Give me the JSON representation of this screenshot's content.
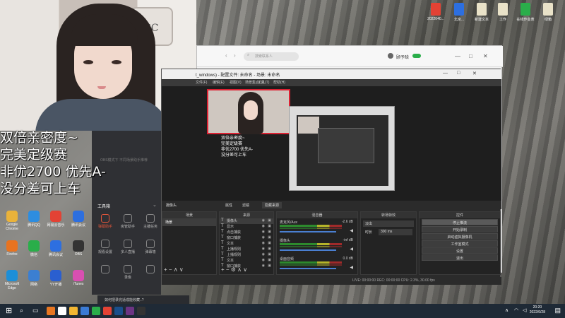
{
  "overlay": {
    "lines": [
      "双倍亲密度~",
      "完美定级赛",
      "非优2700 优先A-",
      "没分差可上车"
    ]
  },
  "camera": {
    "bag_logo": "CC"
  },
  "tool_app": {
    "title": "工具箱",
    "hint": "OBS模式下 不同场景助手推荐",
    "items": [
      "弹幕助手",
      "房管助手",
      "主播任务",
      "观看设置",
      "多人直播",
      "弹幕墙",
      "",
      "录像",
      ""
    ]
  },
  "notification": {
    "text": "如何把录完适成能收藏..?"
  },
  "desktop_left_icons": [
    {
      "label": "Google Chrome",
      "color": "#e9b23a"
    },
    {
      "label": "腾讯QQ",
      "color": "#2d8de0"
    },
    {
      "label": "网易云音乐",
      "color": "#e34234"
    },
    {
      "label": "腾讯会议",
      "color": "#2d6fe0"
    },
    {
      "label": "Firefox",
      "color": "#e8731f"
    },
    {
      "label": "微信",
      "color": "#2aae4a"
    },
    {
      "label": "腾讯会议",
      "color": "#2d6fe0"
    },
    {
      "label": "OBS",
      "color": "#333"
    },
    {
      "label": "Microsoft Edge",
      "color": "#1d8fd8"
    },
    {
      "label": "网络",
      "color": "#3c7fd1"
    },
    {
      "label": "YY开播",
      "color": "#2a5fd0"
    },
    {
      "label": "iTunes",
      "color": "#d94fb1"
    }
  ],
  "desktop_right_files": [
    {
      "label": "2022040...",
      "color": "#e34234"
    },
    {
      "label": "北京...",
      "color": "#2d6fe0"
    },
    {
      "label": "新建文本",
      "color": "#e9e2c8"
    },
    {
      "label": "工作",
      "color": "#e9e2c8"
    },
    {
      "label": "在线作业表",
      "color": "#2aae4a"
    },
    {
      "label": "绿箱",
      "color": "#e9e2c8"
    }
  ],
  "browser": {
    "search_placeholder": "搜索联系人",
    "user_name": "顾予晗",
    "controls": [
      "—",
      "□",
      "✕"
    ]
  },
  "obs": {
    "title": "t_windows) - 配置文件: 未命名 - 场景: 未命名",
    "menu": [
      "文件(F)",
      "编辑(E)",
      "视图(V)",
      "场景集合(S)",
      "工具(T)",
      "帮助(H)"
    ],
    "scene_label": "摄像头",
    "scene_buttons": [
      "属性",
      "滤镜",
      "隐藏来源"
    ],
    "panels": {
      "scenes": "场景",
      "sources": "来源",
      "mixer": "混音器",
      "transitions": "转场特效",
      "controls": "控件"
    },
    "scenes": [
      "场景"
    ],
    "sources": [
      "摄像头",
      "显示",
      "点击捕获",
      "窗口捕获",
      "文本",
      "上播规则",
      "上播规则",
      "文本",
      "窗口捕获"
    ],
    "mixer": [
      {
        "name": "麦克风/Aux",
        "level": "-2.6 dB"
      },
      {
        "name": "摄像头",
        "level": "-inf dB"
      },
      {
        "name": "桌面音频",
        "level": "0.0 dB"
      }
    ],
    "transition": {
      "type": "淡出",
      "duration_label": "时长",
      "duration": "300 ms"
    },
    "control_buttons": [
      "停止推流",
      "开始录制",
      "启动虚拟摄像机",
      "工作室模式",
      "设置",
      "退出"
    ],
    "status": "LIVE: 00:00:00   REC: 00:00:00   CPU: 2.3%, 30.00 fps"
  },
  "taskbar": {
    "time": "20:20",
    "date": "2022/6/28"
  },
  "colors": {
    "obs_bg": "#2b2b2b",
    "taskbar": "#1f2a36",
    "overlay_text": "#ffffff"
  }
}
